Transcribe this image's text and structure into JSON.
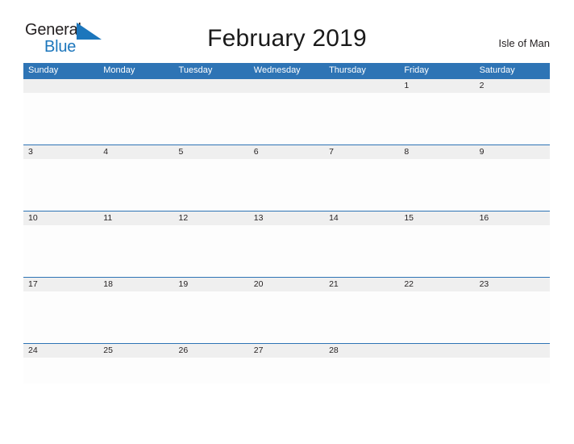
{
  "logo": {
    "word_one": "General",
    "word_two": "Blue",
    "flag_icon": "blue-flag-triangle-icon",
    "colors": {
      "general": "#231f20",
      "blue": "#1c76bc",
      "flag": "#1c76bc"
    }
  },
  "header": {
    "title": "February 2019",
    "region": "Isle of Man"
  },
  "calendar": {
    "month": "February",
    "year": "2019",
    "colors": {
      "weekday_header_bg": "#2e74b5",
      "weekday_header_text": "#ffffff",
      "date_band_bg": "#efefef",
      "date_band_border": "#2e74b5",
      "cell_bg": "#fdfdfd",
      "date_text": "#231f20"
    },
    "weekdays": [
      "Sunday",
      "Monday",
      "Tuesday",
      "Wednesday",
      "Thursday",
      "Friday",
      "Saturday"
    ],
    "weeks": [
      {
        "dates": [
          "",
          "",
          "",
          "",
          "",
          "1",
          "2"
        ],
        "events": [
          "",
          "",
          "",
          "",
          "",
          "",
          ""
        ]
      },
      {
        "dates": [
          "3",
          "4",
          "5",
          "6",
          "7",
          "8",
          "9"
        ],
        "events": [
          "",
          "",
          "",
          "",
          "",
          "",
          ""
        ]
      },
      {
        "dates": [
          "10",
          "11",
          "12",
          "13",
          "14",
          "15",
          "16"
        ],
        "events": [
          "",
          "",
          "",
          "",
          "",
          "",
          ""
        ]
      },
      {
        "dates": [
          "17",
          "18",
          "19",
          "20",
          "21",
          "22",
          "23"
        ],
        "events": [
          "",
          "",
          "",
          "",
          "",
          "",
          ""
        ]
      },
      {
        "dates": [
          "24",
          "25",
          "26",
          "27",
          "28",
          "",
          ""
        ],
        "events": [
          "",
          "",
          "",
          "",
          "",
          "",
          ""
        ]
      }
    ]
  }
}
